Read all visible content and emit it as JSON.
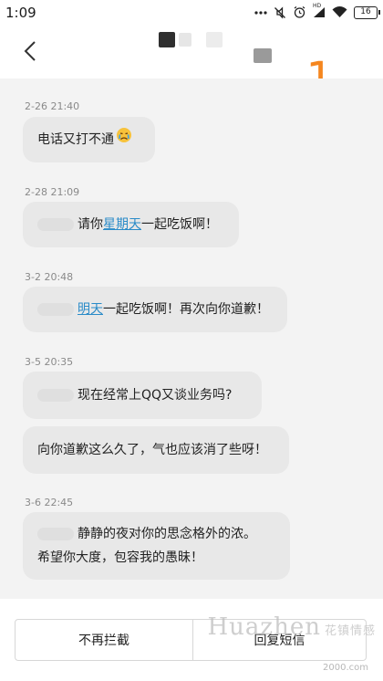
{
  "status_bar": {
    "time": "1:09",
    "battery": "16",
    "network_label": "HD",
    "icons": [
      "dots-icon",
      "mute-icon",
      "alarm-icon",
      "signal-icon",
      "wifi-icon",
      "battery-icon"
    ]
  },
  "header": {
    "page_number": "1"
  },
  "colors": {
    "chat_background": "#f3f3f3",
    "bubble": "#e8e8e8",
    "link": "#2a8bc8",
    "page_number": "#f5861f"
  },
  "messages": [
    {
      "timestamp": "2-26 21:40",
      "text": "电话又打不通"
    },
    {
      "timestamp": "2-28 21:09",
      "text_before": "请你",
      "link": "星期天",
      "text_after": "一起吃饭啊！"
    },
    {
      "timestamp": "3-2 20:48",
      "link": "明天",
      "text_after": "一起吃饭啊！再次向你道歉！"
    },
    {
      "timestamp": "3-5 20:35",
      "text": "现在经常上QQ又谈业务吗?",
      "text_2": "向你道歉这么久了，气也应该消了些呀！"
    },
    {
      "timestamp": "3-6 22:45",
      "line_1": "静静的夜对你的思念格外的浓。",
      "line_2": "希望你大度，包容我的愚昧！"
    }
  ],
  "bottom_bar": {
    "unblock_label": "不再拦截",
    "reply_label": "回复短信"
  },
  "watermark": {
    "brand": "Huazhen",
    "brand_cn": "花镇情感",
    "site": "2000.com"
  }
}
